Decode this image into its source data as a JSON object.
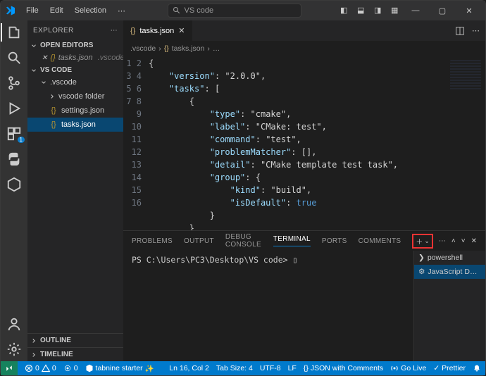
{
  "titlebar": {
    "menus": [
      "File",
      "Edit",
      "Selection"
    ],
    "search_placeholder": "VS code"
  },
  "explorer": {
    "title": "EXPLORER",
    "open_editors_label": "OPEN EDITORS",
    "open_editors": [
      {
        "name": "tasks.json",
        "hint": ".vscode"
      }
    ],
    "workspace_label": "VS CODE",
    "tree": {
      "folder": ".vscode",
      "children": [
        {
          "type": "folder",
          "name": "vscode folder"
        },
        {
          "type": "file",
          "name": "settings.json"
        },
        {
          "type": "file",
          "name": "tasks.json",
          "selected": true
        }
      ]
    },
    "outline_label": "OUTLINE",
    "timeline_label": "TIMELINE"
  },
  "tabs": {
    "active": {
      "name": "tasks.json"
    }
  },
  "breadcrumb": {
    "folder": ".vscode",
    "file": "tasks.json",
    "trail": "…"
  },
  "code": {
    "lines": [
      "{",
      "    \"version\": \"2.0.0\",",
      "    \"tasks\": [",
      "        {",
      "            \"type\": \"cmake\",",
      "            \"label\": \"CMake: test\",",
      "            \"command\": \"test\",",
      "            \"problemMatcher\": [],",
      "            \"detail\": \"CMake template test task\",",
      "            \"group\": {",
      "                \"kind\": \"build\",",
      "                \"isDefault\": true",
      "            }",
      "        }",
      "    ]",
      "}"
    ]
  },
  "panel": {
    "tabs": [
      "PROBLEMS",
      "OUTPUT",
      "DEBUG CONSOLE",
      "TERMINAL",
      "PORTS",
      "COMMENTS"
    ],
    "active_tab": "TERMINAL",
    "prompt": "PS C:\\Users\\PC3\\Desktop\\VS code> ",
    "terminals": [
      {
        "name": "powershell",
        "icon": "shell"
      },
      {
        "name": "JavaScript D…",
        "icon": "debug",
        "selected": true
      }
    ]
  },
  "statusbar": {
    "errors": "0",
    "warnings": "0",
    "ports": "0",
    "tabnine": "tabnine starter",
    "cursor": "Ln 16, Col 2",
    "tabsize": "Tab Size: 4",
    "encoding": "UTF-8",
    "eol": "LF",
    "lang": "JSON with Comments",
    "golive": "Go Live",
    "prettier": "Prettier",
    "bell": ""
  }
}
